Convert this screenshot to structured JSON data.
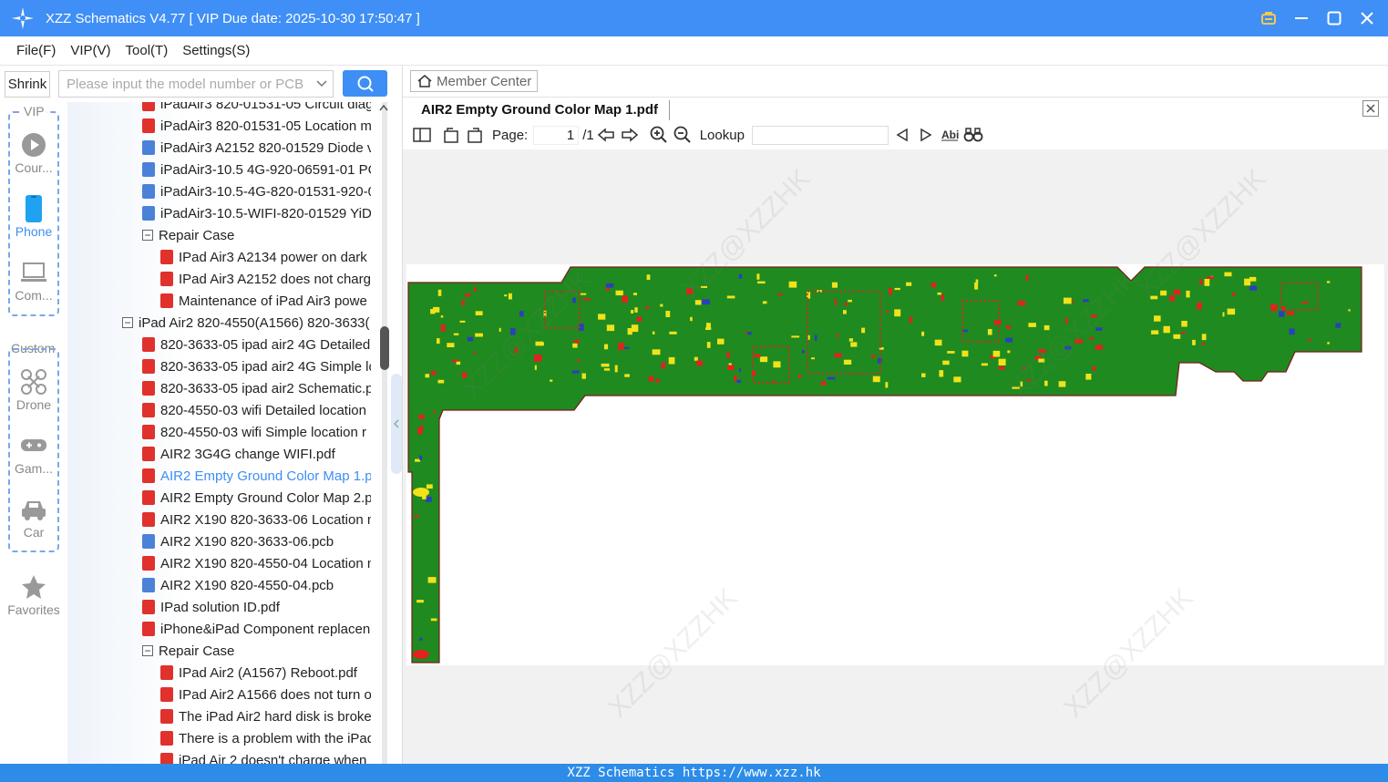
{
  "window": {
    "title": "XZZ Schematics V4.77 [ VIP Due date: 2025-10-30 17:50:47 ]"
  },
  "menu": [
    "File(F)",
    "VIP(V)",
    "Tool(T)",
    "Settings(S)"
  ],
  "toolbar": {
    "shrink_label": "Shrink",
    "search_placeholder": "Please input the model number or PCB"
  },
  "categories": {
    "vip_group_label": "VIP",
    "custom_group_label": "Custom",
    "items": [
      {
        "label": "Cour...",
        "icon": "play-icon"
      },
      {
        "label": "Phone",
        "icon": "phone-icon",
        "active": true
      },
      {
        "label": "Com...",
        "icon": "laptop-icon"
      },
      {
        "label": "Drone",
        "icon": "drone-icon"
      },
      {
        "label": "Gam...",
        "icon": "gamepad-icon"
      },
      {
        "label": "Car",
        "icon": "car-icon"
      },
      {
        "label": "Favorites",
        "icon": "star-icon"
      }
    ]
  },
  "tree": [
    {
      "label": "iPadAir3 820-01531-05 Circuit diag",
      "type": "pdf",
      "level": 2
    },
    {
      "label": "iPadAir3 820-01531-05 Location m",
      "type": "pdf",
      "level": 2
    },
    {
      "label": "iPadAir3 A2152 820-01529 Diode v",
      "type": "pcb",
      "level": 2
    },
    {
      "label": "iPadAir3-10.5 4G-920-06591-01 PC",
      "type": "pcb",
      "level": 2
    },
    {
      "label": "iPadAir3-10.5-4G-820-01531-920-0",
      "type": "pcb",
      "level": 2
    },
    {
      "label": "iPadAir3-10.5-WIFI-820-01529 YiDi",
      "type": "pcb",
      "level": 2
    },
    {
      "label": "Repair Case",
      "type": "folder",
      "level": 2
    },
    {
      "label": "IPad Air3 A2134 power on dark",
      "type": "pdf",
      "level": 3
    },
    {
      "label": "IPad Air3 A2152 does not charg",
      "type": "pdf",
      "level": 3
    },
    {
      "label": "Maintenance of iPad Air3 powe",
      "type": "pdf",
      "level": 3
    },
    {
      "label": "iPad Air2 820-4550(A1566) 820-3633(",
      "type": "folder",
      "level": 1
    },
    {
      "label": "820-3633-05 ipad air2 4G Detailed",
      "type": "pdf",
      "level": 2
    },
    {
      "label": "820-3633-05 ipad air2 4G Simple lo",
      "type": "pdf",
      "level": 2
    },
    {
      "label": "820-3633-05 ipad air2 Schematic.p",
      "type": "pdf",
      "level": 2
    },
    {
      "label": "820-4550-03 wifi Detailed location",
      "type": "pdf",
      "level": 2
    },
    {
      "label": "820-4550-03 wifi Simple location r",
      "type": "pdf",
      "level": 2
    },
    {
      "label": "AIR2 3G4G change WIFI.pdf",
      "type": "pdf",
      "level": 2
    },
    {
      "label": "AIR2 Empty Ground Color Map 1.p",
      "type": "pdf",
      "level": 2,
      "selected": true
    },
    {
      "label": "AIR2 Empty Ground Color Map 2.p",
      "type": "pdf",
      "level": 2
    },
    {
      "label": "AIR2 X190 820-3633-06 Location m",
      "type": "pdf",
      "level": 2
    },
    {
      "label": "AIR2 X190 820-3633-06.pcb",
      "type": "pcb",
      "level": 2
    },
    {
      "label": "AIR2 X190 820-4550-04 Location m",
      "type": "pdf",
      "level": 2
    },
    {
      "label": "AIR2 X190 820-4550-04.pcb",
      "type": "pcb",
      "level": 2
    },
    {
      "label": "IPad solution ID.pdf",
      "type": "pdf",
      "level": 2
    },
    {
      "label": "iPhone&iPad Component replacen",
      "type": "pdf",
      "level": 2
    },
    {
      "label": "Repair Case",
      "type": "folder",
      "level": 2
    },
    {
      "label": "IPad Air2 (A1567) Reboot.pdf",
      "type": "pdf",
      "level": 3
    },
    {
      "label": "IPad Air2 A1566 does not turn o",
      "type": "pdf",
      "level": 3
    },
    {
      "label": "The iPad Air2 hard disk is broke",
      "type": "pdf",
      "level": 3
    },
    {
      "label": "There is a problem with the iPad",
      "type": "pdf",
      "level": 3
    },
    {
      "label": "iPad Air 2 doesn't charge when",
      "type": "pdf",
      "level": 3
    }
  ],
  "viewer": {
    "member_center_label": "Member Center",
    "document_name": "AIR2 Empty Ground Color Map 1.pdf",
    "page_label": "Page:",
    "page_current": "1",
    "page_total": "/1",
    "lookup_label": "Lookup",
    "lookup_value": "",
    "watermark": "XZZ@XZZHK"
  },
  "status": {
    "text": "XZZ Schematics https://www.xzz.hk"
  },
  "colors": {
    "accent": "#3d8ef5",
    "titlebar": "#3f8ff6",
    "statusbar": "#2d8ce8",
    "pcb_green": "#1f8a1f",
    "pcb_red": "#e0231e",
    "pcb_yellow": "#f2e21a"
  }
}
